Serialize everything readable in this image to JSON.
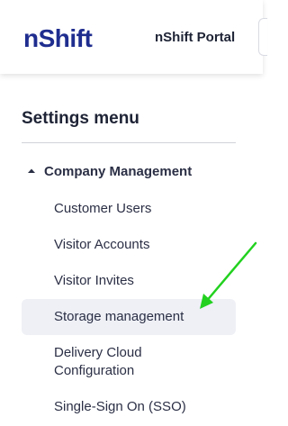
{
  "header": {
    "logo_text": "nShift",
    "portal_title": "nShift Portal"
  },
  "settings": {
    "heading": "Settings menu",
    "group": {
      "label": "Company Management",
      "expanded": true,
      "items": [
        {
          "label": "Customer Users",
          "selected": false
        },
        {
          "label": "Visitor Accounts",
          "selected": false
        },
        {
          "label": "Visitor Invites",
          "selected": false
        },
        {
          "label": "Storage management",
          "selected": true
        },
        {
          "label": "Delivery Cloud Configuration",
          "selected": false
        },
        {
          "label": "Single-Sign On (SSO)",
          "selected": false
        }
      ]
    }
  },
  "colors": {
    "brand": "#1f2d8f",
    "selected_bg": "#eef0f6",
    "annotation_arrow": "#22d11f"
  },
  "icons": {
    "group_toggle": "caret-up-icon",
    "annotation": "arrow-icon"
  }
}
